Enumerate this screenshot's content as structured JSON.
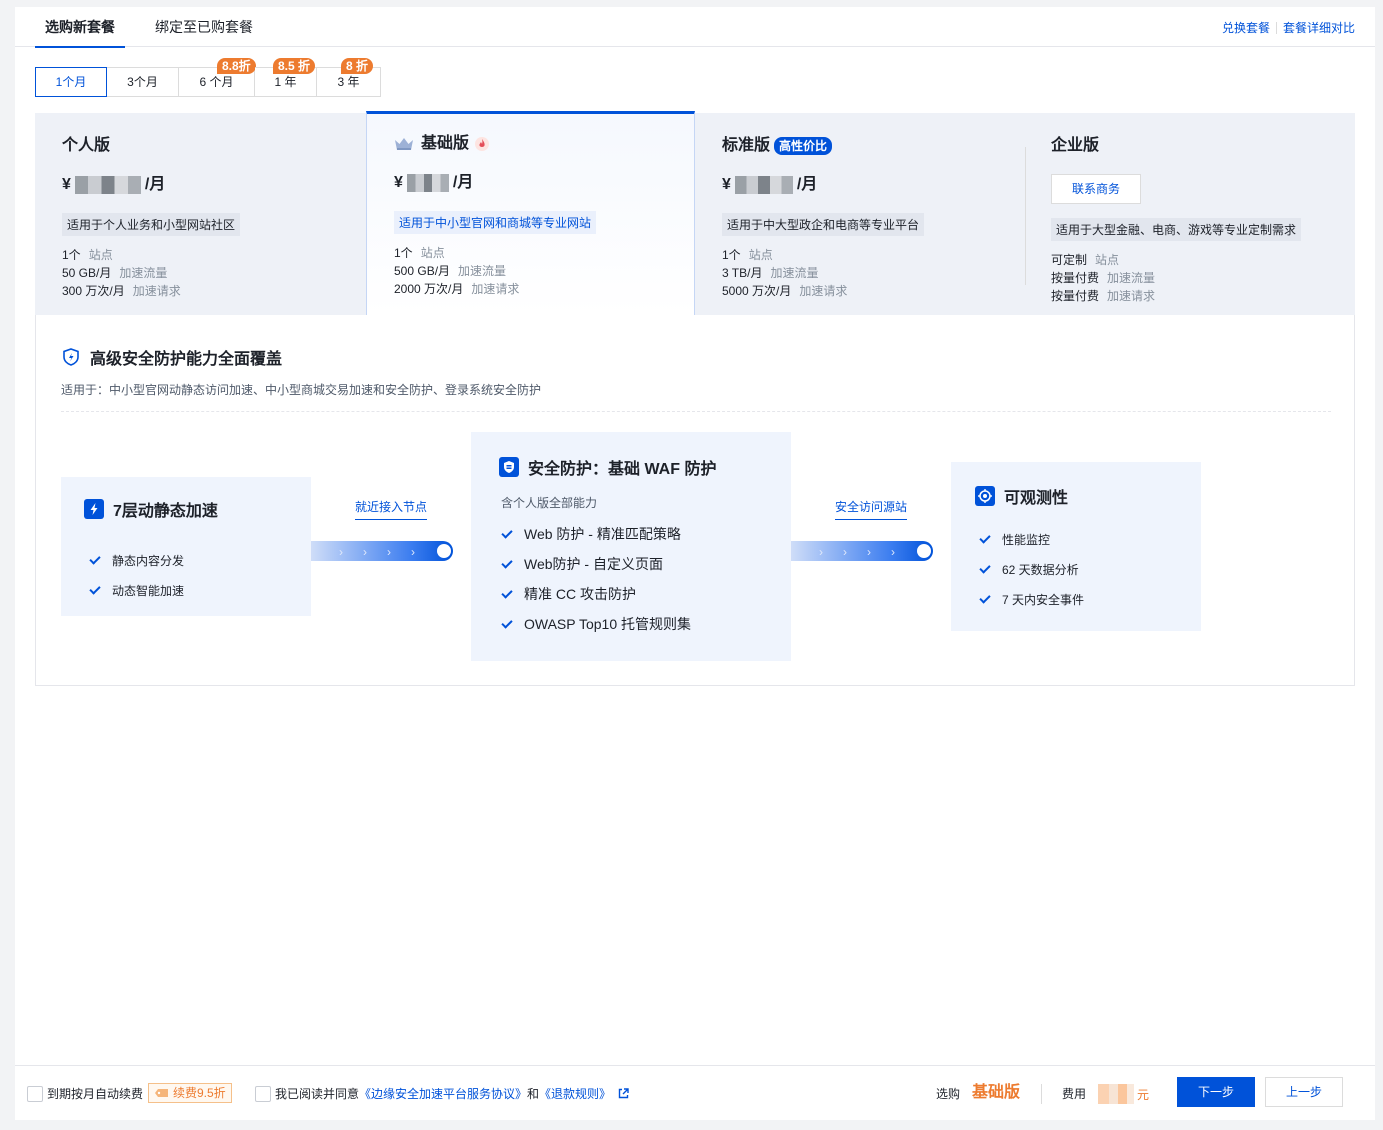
{
  "tabs": {
    "buy_new": "选购新套餐",
    "bind_existing": "绑定至已购套餐"
  },
  "top_links": {
    "redeem": "兑换套餐",
    "compare": "套餐详细对比"
  },
  "durations": [
    {
      "label": "1个月",
      "discount": ""
    },
    {
      "label": "3个月",
      "discount": ""
    },
    {
      "label": "6 个月",
      "discount": "8.8折"
    },
    {
      "label": "1 年",
      "discount": "8.5 折"
    },
    {
      "label": "3 年",
      "discount": "8 折"
    }
  ],
  "selected_duration": "1个月",
  "plans": [
    {
      "name": "个人版",
      "badge": "",
      "currency": "¥",
      "price_unit": "/月",
      "desc": "适用于个人业务和小型网站社区",
      "features": [
        {
          "value": "1个",
          "label": "站点"
        },
        {
          "value": "50 GB/月",
          "label": "加速流量"
        },
        {
          "value": "300 万次/月",
          "label": "加速请求"
        }
      ]
    },
    {
      "name": "基础版",
      "badge": "",
      "currency": "¥",
      "price_unit": "/月",
      "desc": "适用于中小型官网和商城等专业网站",
      "features": [
        {
          "value": "1个",
          "label": "站点"
        },
        {
          "value": "500 GB/月",
          "label": "加速流量"
        },
        {
          "value": "2000 万次/月",
          "label": "加速请求"
        }
      ]
    },
    {
      "name": "标准版",
      "badge": "高性价比",
      "currency": "¥",
      "price_unit": "/月",
      "desc": "适用于中大型政企和电商等专业平台",
      "features": [
        {
          "value": "1个",
          "label": "站点"
        },
        {
          "value": "3 TB/月",
          "label": "加速流量"
        },
        {
          "value": "5000 万次/月",
          "label": "加速请求"
        }
      ]
    },
    {
      "name": "企业版",
      "badge": "",
      "contact": "联系商务",
      "desc": "适用于大型金融、电商、游戏等专业定制需求",
      "features": [
        {
          "value": "可定制",
          "label": "站点"
        },
        {
          "value": "按量付费",
          "label": "加速流量"
        },
        {
          "value": "按量付费",
          "label": "加速请求"
        }
      ]
    }
  ],
  "detail": {
    "title": "高级安全防护能力全面覆盖",
    "subtitle": "适用于：中小型官网动静态访问加速、中小型商城交易加速和安全防护、登录系统安全防护",
    "cards": [
      {
        "title": "7层动静态加速",
        "subtitle": "",
        "items": [
          "静态内容分发",
          "动态智能加速"
        ]
      },
      {
        "title": "安全防护：基础 WAF 防护",
        "subtitle": "含个人版全部能力",
        "items": [
          "Web 防护 - 精准匹配策略",
          "Web防护 - 自定义页面",
          "精准 CC 攻击防护",
          "OWASP Top10 托管规则集"
        ]
      },
      {
        "title": "可观测性",
        "subtitle": "",
        "items": [
          "性能监控",
          "62 天数据分析",
          "7 天内安全事件"
        ]
      }
    ],
    "connectors": [
      "就近接入节点",
      "安全访问源站"
    ]
  },
  "footer": {
    "auto_renew": "到期按月自动续费",
    "renew_discount": "续费9.5折",
    "agree_prefix": "我已阅读并同意",
    "agreement_link": "《边缘安全加速平台服务协议》",
    "and": "和",
    "refund_link": "《退款规则》",
    "selected_label": "选购",
    "selected_plan": "基础版",
    "cost_label": "费用",
    "currency_unit": "元",
    "next": "下一步",
    "prev": "上一步"
  },
  "colors": {
    "primary": "#0052d9",
    "orange": "#ed7b2f",
    "card_bg": "#eff4fd"
  }
}
